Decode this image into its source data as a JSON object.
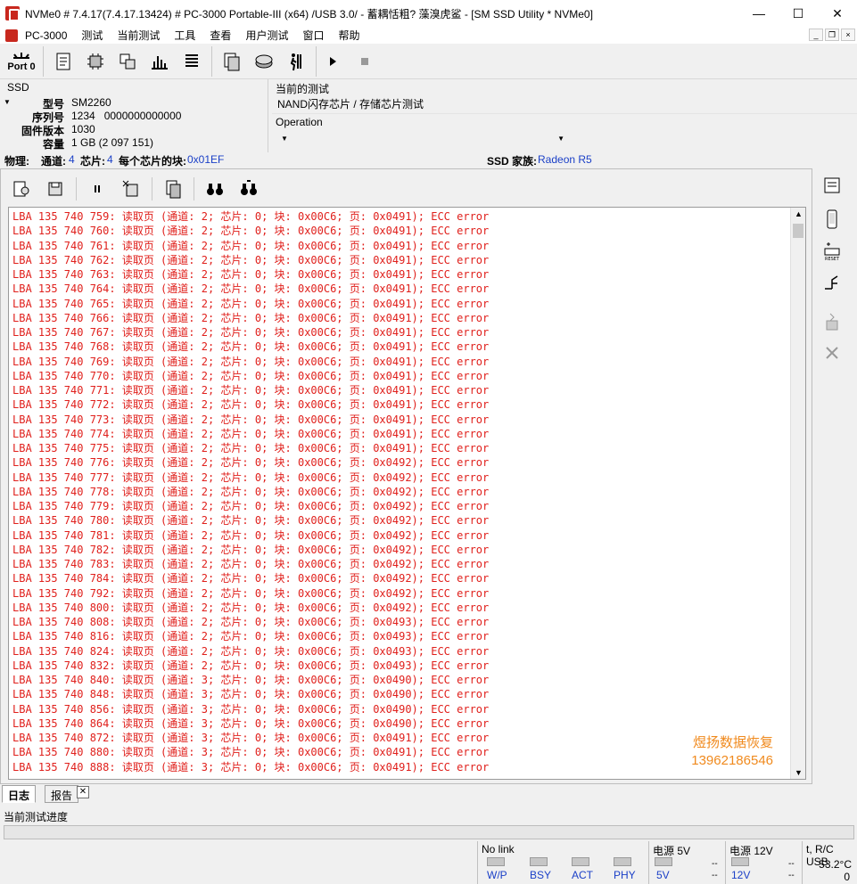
{
  "window": {
    "title": "NVMe0 # 7.4.17(7.4.17.13424) # PC-3000 Portable-III (x64) /USB 3.0/ - 蓄耦恬粗? 藻溴虎鲨    - [SM SSD Utility * NVMe0]",
    "minimize": "—",
    "maximize": "☐",
    "close": "✕"
  },
  "menu": {
    "items": [
      "PC-3000",
      "测试",
      "当前测试",
      "工具",
      "查看",
      "用户测试",
      "窗口",
      "帮助"
    ],
    "mdi_min": "_",
    "mdi_restore": "❐",
    "mdi_close": "×"
  },
  "toolbar": {
    "port_label": "Port 0"
  },
  "ssd": {
    "section_label": "SSD",
    "fields": [
      {
        "key": "型号",
        "value": "SM2260"
      },
      {
        "key": "序列号",
        "value": "1234   0000000000000"
      },
      {
        "key": "固件版本",
        "value": "1030"
      },
      {
        "key": "容量",
        "value": "1 GB (2 097 151)"
      }
    ]
  },
  "current_test": {
    "label": "当前的测试",
    "value": "NAND闪存芯片 / 存储芯片测试",
    "operation_label": "Operation"
  },
  "physical": {
    "label": "物理:",
    "channels_label": "通道:",
    "channels": "4",
    "chips_label": "芯片:",
    "chips": "4",
    "blocks_label": "每个芯片的块:",
    "blocks": "0x01EF",
    "family_label": "SSD 家族:",
    "family": "Radeon R5"
  },
  "log": {
    "lines": [
      "LBA 135 740 759: 读取页 (通道: 2; 芯片: 0; 块: 0x00C6; 页: 0x0491); ECC error",
      "LBA 135 740 760: 读取页 (通道: 2; 芯片: 0; 块: 0x00C6; 页: 0x0491); ECC error",
      "LBA 135 740 761: 读取页 (通道: 2; 芯片: 0; 块: 0x00C6; 页: 0x0491); ECC error",
      "LBA 135 740 762: 读取页 (通道: 2; 芯片: 0; 块: 0x00C6; 页: 0x0491); ECC error",
      "LBA 135 740 763: 读取页 (通道: 2; 芯片: 0; 块: 0x00C6; 页: 0x0491); ECC error",
      "LBA 135 740 764: 读取页 (通道: 2; 芯片: 0; 块: 0x00C6; 页: 0x0491); ECC error",
      "LBA 135 740 765: 读取页 (通道: 2; 芯片: 0; 块: 0x00C6; 页: 0x0491); ECC error",
      "LBA 135 740 766: 读取页 (通道: 2; 芯片: 0; 块: 0x00C6; 页: 0x0491); ECC error",
      "LBA 135 740 767: 读取页 (通道: 2; 芯片: 0; 块: 0x00C6; 页: 0x0491); ECC error",
      "LBA 135 740 768: 读取页 (通道: 2; 芯片: 0; 块: 0x00C6; 页: 0x0491); ECC error",
      "LBA 135 740 769: 读取页 (通道: 2; 芯片: 0; 块: 0x00C6; 页: 0x0491); ECC error",
      "LBA 135 740 770: 读取页 (通道: 2; 芯片: 0; 块: 0x00C6; 页: 0x0491); ECC error",
      "LBA 135 740 771: 读取页 (通道: 2; 芯片: 0; 块: 0x00C6; 页: 0x0491); ECC error",
      "LBA 135 740 772: 读取页 (通道: 2; 芯片: 0; 块: 0x00C6; 页: 0x0491); ECC error",
      "LBA 135 740 773: 读取页 (通道: 2; 芯片: 0; 块: 0x00C6; 页: 0x0491); ECC error",
      "LBA 135 740 774: 读取页 (通道: 2; 芯片: 0; 块: 0x00C6; 页: 0x0491); ECC error",
      "LBA 135 740 775: 读取页 (通道: 2; 芯片: 0; 块: 0x00C6; 页: 0x0491); ECC error",
      "LBA 135 740 776: 读取页 (通道: 2; 芯片: 0; 块: 0x00C6; 页: 0x0492); ECC error",
      "LBA 135 740 777: 读取页 (通道: 2; 芯片: 0; 块: 0x00C6; 页: 0x0492); ECC error",
      "LBA 135 740 778: 读取页 (通道: 2; 芯片: 0; 块: 0x00C6; 页: 0x0492); ECC error",
      "LBA 135 740 779: 读取页 (通道: 2; 芯片: 0; 块: 0x00C6; 页: 0x0492); ECC error",
      "LBA 135 740 780: 读取页 (通道: 2; 芯片: 0; 块: 0x00C6; 页: 0x0492); ECC error",
      "LBA 135 740 781: 读取页 (通道: 2; 芯片: 0; 块: 0x00C6; 页: 0x0492); ECC error",
      "LBA 135 740 782: 读取页 (通道: 2; 芯片: 0; 块: 0x00C6; 页: 0x0492); ECC error",
      "LBA 135 740 783: 读取页 (通道: 2; 芯片: 0; 块: 0x00C6; 页: 0x0492); ECC error",
      "LBA 135 740 784: 读取页 (通道: 2; 芯片: 0; 块: 0x00C6; 页: 0x0492); ECC error",
      "LBA 135 740 792: 读取页 (通道: 2; 芯片: 0; 块: 0x00C6; 页: 0x0492); ECC error",
      "LBA 135 740 800: 读取页 (通道: 2; 芯片: 0; 块: 0x00C6; 页: 0x0492); ECC error",
      "LBA 135 740 808: 读取页 (通道: 2; 芯片: 0; 块: 0x00C6; 页: 0x0493); ECC error",
      "LBA 135 740 816: 读取页 (通道: 2; 芯片: 0; 块: 0x00C6; 页: 0x0493); ECC error",
      "LBA 135 740 824: 读取页 (通道: 2; 芯片: 0; 块: 0x00C6; 页: 0x0493); ECC error",
      "LBA 135 740 832: 读取页 (通道: 2; 芯片: 0; 块: 0x00C6; 页: 0x0493); ECC error",
      "LBA 135 740 840: 读取页 (通道: 3; 芯片: 0; 块: 0x00C6; 页: 0x0490); ECC error",
      "LBA 135 740 848: 读取页 (通道: 3; 芯片: 0; 块: 0x00C6; 页: 0x0490); ECC error",
      "LBA 135 740 856: 读取页 (通道: 3; 芯片: 0; 块: 0x00C6; 页: 0x0490); ECC error",
      "LBA 135 740 864: 读取页 (通道: 3; 芯片: 0; 块: 0x00C6; 页: 0x0490); ECC error",
      "LBA 135 740 872: 读取页 (通道: 3; 芯片: 0; 块: 0x00C6; 页: 0x0491); ECC error",
      "LBA 135 740 880: 读取页 (通道: 3; 芯片: 0; 块: 0x00C6; 页: 0x0491); ECC error",
      "LBA 135 740 888: 读取页 (通道: 3; 芯片: 0; 块: 0x00C6; 页: 0x0491); ECC error"
    ],
    "text_color": "#e0201c",
    "watermark_line1": "煜扬数据恢复",
    "watermark_line2": "13962186546"
  },
  "tabs": {
    "log": "日志",
    "report": "报告",
    "close": "✕"
  },
  "progress": {
    "label": "当前测试进度",
    "value": 0
  },
  "status": {
    "link_label": "No link",
    "leds": [
      "W/P",
      "BSY",
      "ACT",
      "PHY"
    ],
    "power5_label": "电源 5V",
    "power5_led": "5V",
    "power12_label": "电源 12V",
    "power12_led": "12V",
    "dash": "--",
    "temp_label": "t, R/C USB",
    "temp_value": "53.2°C",
    "rc_value": "0"
  }
}
